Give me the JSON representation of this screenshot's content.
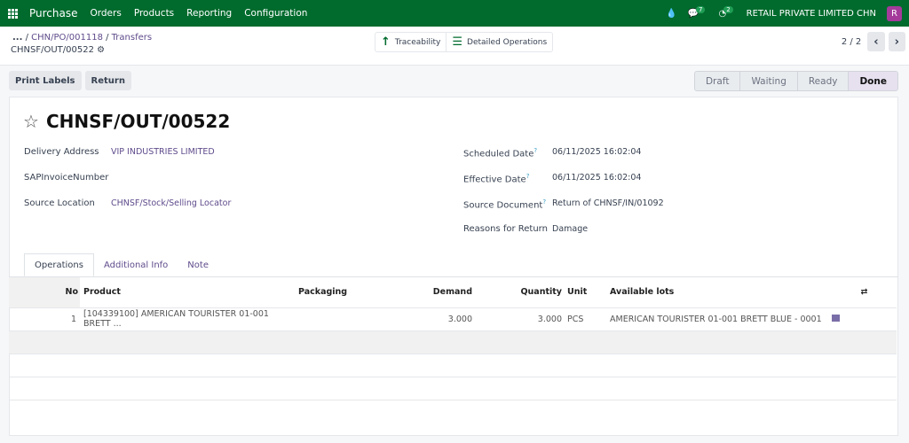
{
  "nav": {
    "app": "Purchase",
    "menu": [
      "Orders",
      "Products",
      "Reporting",
      "Configuration"
    ],
    "messages_count": "7",
    "activities_count": "2",
    "company": "RETAIL PRIVATE LIMITED CHN",
    "avatar": "R"
  },
  "breadcrumb": {
    "ellipsis": "...",
    "items": [
      "CHN/PO/001118",
      "Transfers"
    ],
    "current": "CHNSF/OUT/00522"
  },
  "smart_buttons": {
    "traceability": "Traceability",
    "detailed": "Detailed Operations"
  },
  "pager": {
    "value": "2 / 2"
  },
  "actions": {
    "print": "Print Labels",
    "return": "Return"
  },
  "statusbar": {
    "stages": [
      "Draft",
      "Waiting",
      "Ready",
      "Done"
    ],
    "current": "Done"
  },
  "record": {
    "title": "CHNSF/OUT/00522",
    "left": [
      {
        "label": "Delivery Address",
        "value": "VIP INDUSTRIES LIMITED",
        "link": true
      },
      {
        "label": "SAPInvoiceNumber",
        "value": ""
      },
      {
        "label": "Source Location",
        "value": "CHNSF/Stock/Selling Locator",
        "link": true
      }
    ],
    "right": [
      {
        "label": "Scheduled Date",
        "help": "?",
        "value": "06/11/2025 16:02:04"
      },
      {
        "label": "Effective Date",
        "help": "?",
        "value": "06/11/2025 16:02:04"
      },
      {
        "label": "Source Document",
        "help": "?",
        "value": "Return of CHNSF/IN/01092"
      },
      {
        "label": "Reasons for Return",
        "help": "",
        "value": "Damage"
      }
    ]
  },
  "tabs": [
    "Operations",
    "Additional Info",
    "Note"
  ],
  "table": {
    "headers": [
      "No",
      "Product",
      "Packaging",
      "Demand",
      "Quantity",
      "Unit",
      "Available lots"
    ],
    "rows": [
      {
        "no": "1",
        "product": "[104339100] AMERICAN TOURISTER 01-001 BRETT ...",
        "packaging": "",
        "demand": "3.000",
        "quantity": "3.000",
        "unit": "PCS",
        "lots": "AMERICAN TOURISTER 01-001 BRETT BLUE - 0001"
      }
    ]
  },
  "colors": {
    "nav": "#006b2d",
    "accent": "#5f4b8b",
    "avatar": "#a43b9b"
  }
}
